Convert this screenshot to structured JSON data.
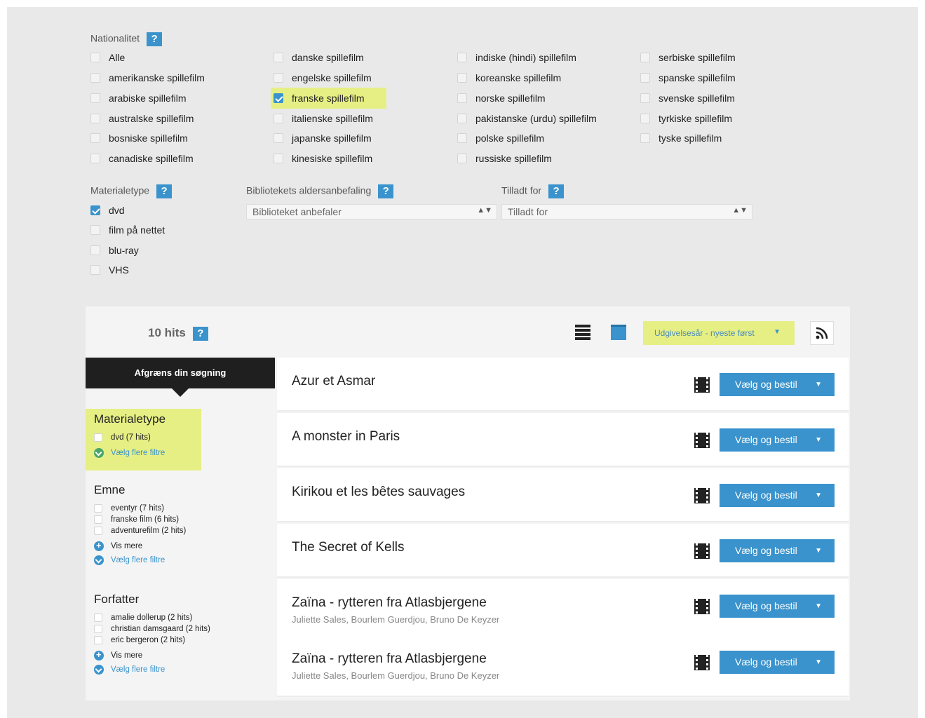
{
  "filters": {
    "nationality": {
      "title": "Nationalitet",
      "help": "?",
      "columns": [
        [
          {
            "label": "Alle",
            "checked": false
          },
          {
            "label": "amerikanske spillefilm",
            "checked": false
          },
          {
            "label": "arabiske spillefilm",
            "checked": false
          },
          {
            "label": "australske spillefilm",
            "checked": false
          },
          {
            "label": "bosniske spillefilm",
            "checked": false
          },
          {
            "label": "canadiske spillefilm",
            "checked": false
          }
        ],
        [
          {
            "label": "danske spillefilm",
            "checked": false
          },
          {
            "label": "engelske spillefilm",
            "checked": false
          },
          {
            "label": "franske spillefilm",
            "checked": true
          },
          {
            "label": "italienske spillefilm",
            "checked": false
          },
          {
            "label": "japanske spillefilm",
            "checked": false
          },
          {
            "label": "kinesiske spillefilm",
            "checked": false
          }
        ],
        [
          {
            "label": "indiske (hindi) spillefilm",
            "checked": false
          },
          {
            "label": "koreanske spillefilm",
            "checked": false
          },
          {
            "label": "norske spillefilm",
            "checked": false
          },
          {
            "label": "pakistanske (urdu) spillefilm",
            "checked": false
          },
          {
            "label": "polske spillefilm",
            "checked": false
          },
          {
            "label": "russiske spillefilm",
            "checked": false
          }
        ],
        [
          {
            "label": "serbiske spillefilm",
            "checked": false
          },
          {
            "label": "spanske spillefilm",
            "checked": false
          },
          {
            "label": "svenske spillefilm",
            "checked": false
          },
          {
            "label": "tyrkiske spillefilm",
            "checked": false
          },
          {
            "label": "tyske spillefilm",
            "checked": false
          }
        ]
      ]
    },
    "material": {
      "title": "Materialetype",
      "help": "?",
      "items": [
        {
          "label": "dvd",
          "checked": true
        },
        {
          "label": "film på nettet",
          "checked": false
        },
        {
          "label": "blu-ray",
          "checked": false
        },
        {
          "label": "VHS",
          "checked": false
        }
      ]
    },
    "age": {
      "title": "Bibliotekets aldersanbefaling",
      "help": "?",
      "value": "Biblioteket anbefaler"
    },
    "allowed": {
      "title": "Tilladt for",
      "help": "?",
      "value": "Tilladt for"
    }
  },
  "results_bar": {
    "hits": "10 hits",
    "help": "?",
    "sort_label": "Udgivelsesår - nyeste først",
    "caret": "▼",
    "rss_icon": "rss-icon"
  },
  "sidebar": {
    "header": "Afgræns din søgning",
    "facets": [
      {
        "title": "Materialetype",
        "items": [
          "dvd (7 hits)"
        ],
        "links": [
          {
            "label": "Vælg flere filtre",
            "icon": "check"
          }
        ]
      },
      {
        "title": "Emne",
        "items": [
          "eventyr (7 hits)",
          "franske film (6 hits)",
          "adventurefilm (2 hits)"
        ],
        "links": [
          {
            "label": "Vis mere",
            "icon": "plus"
          },
          {
            "label": "Vælg flere filtre",
            "icon": "check"
          }
        ]
      },
      {
        "title": "Forfatter",
        "items": [
          "amalie dollerup (2 hits)",
          "christian damsgaard (2 hits)",
          "eric bergeron (2 hits)"
        ],
        "links": [
          {
            "label": "Vis mere",
            "icon": "plus"
          },
          {
            "label": "Vælg flere filtre",
            "icon": "check"
          }
        ]
      }
    ]
  },
  "results": [
    {
      "title": "Azur et Asmar",
      "subtitle": "",
      "button": "Vælg og bestil"
    },
    {
      "title": "A monster in Paris",
      "subtitle": "",
      "button": "Vælg og bestil"
    },
    {
      "title": "Kirikou et les bêtes sauvages",
      "subtitle": "",
      "button": "Vælg og bestil"
    },
    {
      "title": "The Secret of Kells",
      "subtitle": "",
      "button": "Vælg og bestil"
    },
    {
      "title": "Zaïna - rytteren fra Atlasbjergene",
      "subtitle": "Juliette Sales, Bourlem Guerdjou, Bruno De Keyzer",
      "button": "Vælg og bestil"
    },
    {
      "title": "Zaïna - rytteren fra Atlasbjergene",
      "subtitle": "Juliette Sales, Bourlem Guerdjou, Bruno De Keyzer",
      "button": "Vælg og bestil"
    }
  ],
  "colors": {
    "accent": "#3a93cc",
    "highlight": "#e6ef84",
    "dark": "#1f1f1f"
  }
}
